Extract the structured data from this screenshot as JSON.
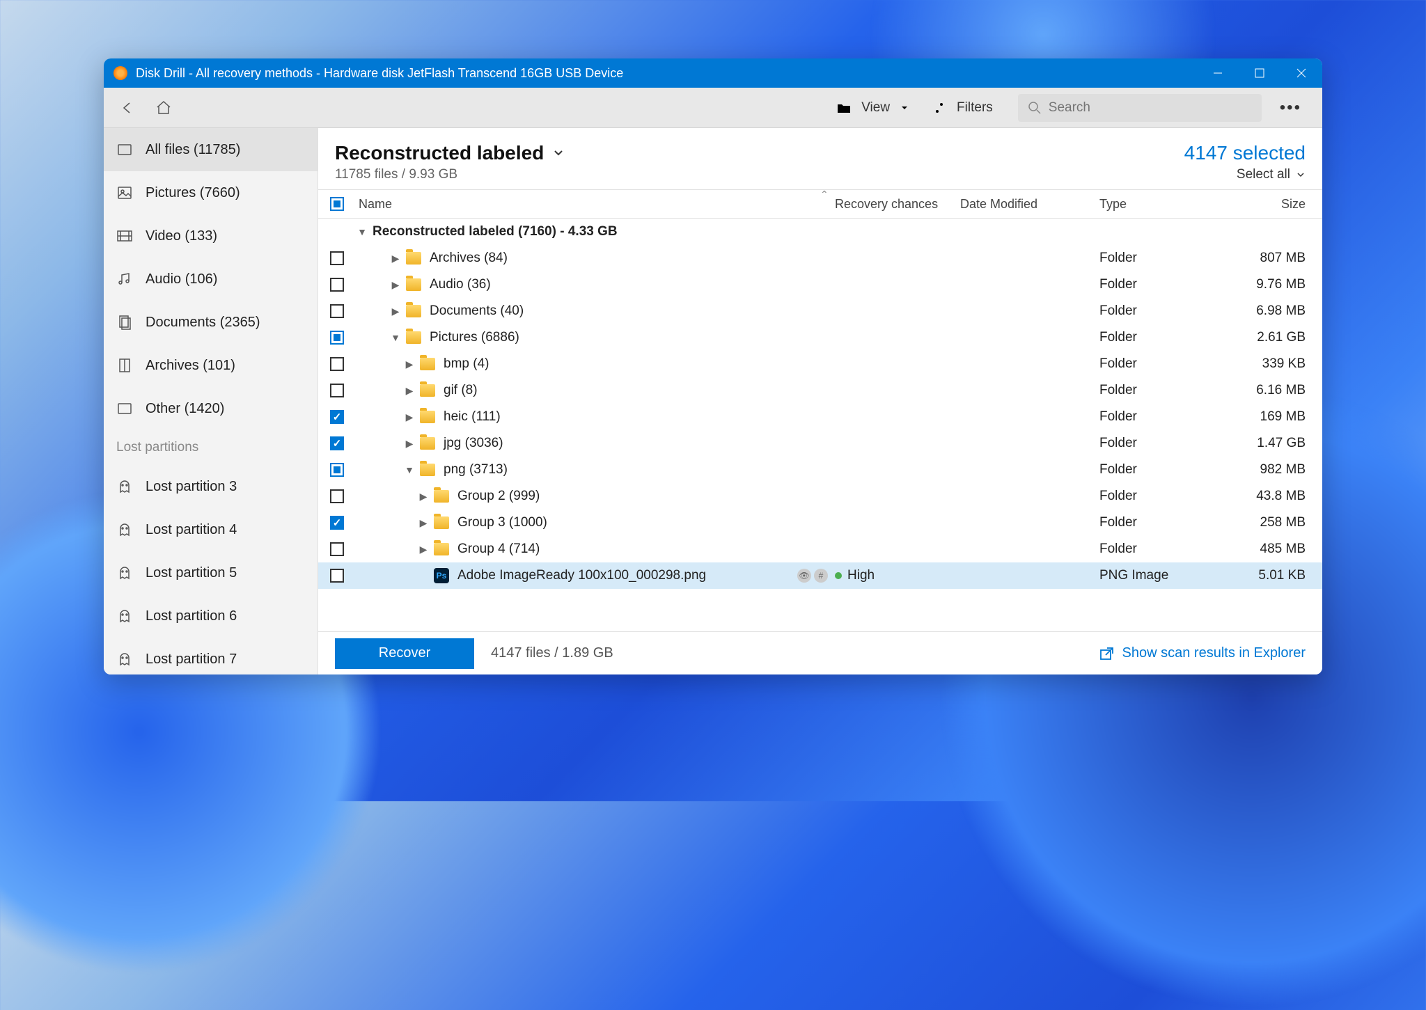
{
  "window": {
    "title": "Disk Drill - All recovery methods - Hardware disk JetFlash Transcend 16GB USB Device"
  },
  "toolbar": {
    "view": "View",
    "filters": "Filters",
    "search_placeholder": "Search"
  },
  "sidebar": {
    "items": [
      {
        "icon": "all",
        "label": "All files (11785)",
        "active": true
      },
      {
        "icon": "pictures",
        "label": "Pictures (7660)"
      },
      {
        "icon": "video",
        "label": "Video (133)"
      },
      {
        "icon": "audio",
        "label": "Audio (106)"
      },
      {
        "icon": "documents",
        "label": "Documents (2365)"
      },
      {
        "icon": "archives",
        "label": "Archives (101)"
      },
      {
        "icon": "other",
        "label": "Other (1420)"
      }
    ],
    "section_header": "Lost partitions",
    "partitions": [
      "Lost partition 3",
      "Lost partition 4",
      "Lost partition 5",
      "Lost partition 6",
      "Lost partition 7"
    ]
  },
  "main": {
    "title": "Reconstructed labeled",
    "subtitle": "11785 files / 9.93 GB",
    "selected_count": "4147 selected",
    "select_all": "Select all"
  },
  "columns": {
    "name": "Name",
    "recovery": "Recovery chances",
    "date": "Date Modified",
    "type": "Type",
    "size": "Size"
  },
  "group_header": "Reconstructed labeled (7160) - 4.33 GB",
  "rows": [
    {
      "check": "none",
      "indent": 0,
      "expand": "right",
      "kind": "folder",
      "name": "Archives (84)",
      "type": "Folder",
      "size": "807 MB"
    },
    {
      "check": "none",
      "indent": 0,
      "expand": "right",
      "kind": "folder",
      "name": "Audio (36)",
      "type": "Folder",
      "size": "9.76 MB"
    },
    {
      "check": "none",
      "indent": 0,
      "expand": "right",
      "kind": "folder",
      "name": "Documents (40)",
      "type": "Folder",
      "size": "6.98 MB"
    },
    {
      "check": "partial",
      "indent": 0,
      "expand": "down",
      "kind": "folder",
      "name": "Pictures (6886)",
      "type": "Folder",
      "size": "2.61 GB"
    },
    {
      "check": "none",
      "indent": 1,
      "expand": "right",
      "kind": "folder",
      "name": "bmp (4)",
      "type": "Folder",
      "size": "339 KB"
    },
    {
      "check": "none",
      "indent": 1,
      "expand": "right",
      "kind": "folder",
      "name": "gif (8)",
      "type": "Folder",
      "size": "6.16 MB"
    },
    {
      "check": "checked",
      "indent": 1,
      "expand": "right",
      "kind": "folder",
      "name": "heic (111)",
      "type": "Folder",
      "size": "169 MB"
    },
    {
      "check": "checked",
      "indent": 1,
      "expand": "right",
      "kind": "folder",
      "name": "jpg (3036)",
      "type": "Folder",
      "size": "1.47 GB"
    },
    {
      "check": "partial",
      "indent": 1,
      "expand": "down",
      "kind": "folder",
      "name": "png (3713)",
      "type": "Folder",
      "size": "982 MB"
    },
    {
      "check": "none",
      "indent": 2,
      "expand": "right",
      "kind": "folder",
      "name": "Group 2 (999)",
      "type": "Folder",
      "size": "43.8 MB"
    },
    {
      "check": "checked",
      "indent": 2,
      "expand": "right",
      "kind": "folder",
      "name": "Group 3 (1000)",
      "type": "Folder",
      "size": "258 MB"
    },
    {
      "check": "none",
      "indent": 2,
      "expand": "right",
      "kind": "folder",
      "name": "Group 4 (714)",
      "type": "Folder",
      "size": "485 MB"
    },
    {
      "check": "none",
      "indent": 2,
      "expand": "",
      "kind": "file",
      "name": "Adobe ImageReady 100x100_000298.png",
      "recovery": "High",
      "type": "PNG Image",
      "size": "5.01 KB",
      "selected": true,
      "badges": true
    }
  ],
  "footer": {
    "recover": "Recover",
    "stats": "4147 files / 1.89 GB",
    "explorer": "Show scan results in Explorer"
  }
}
